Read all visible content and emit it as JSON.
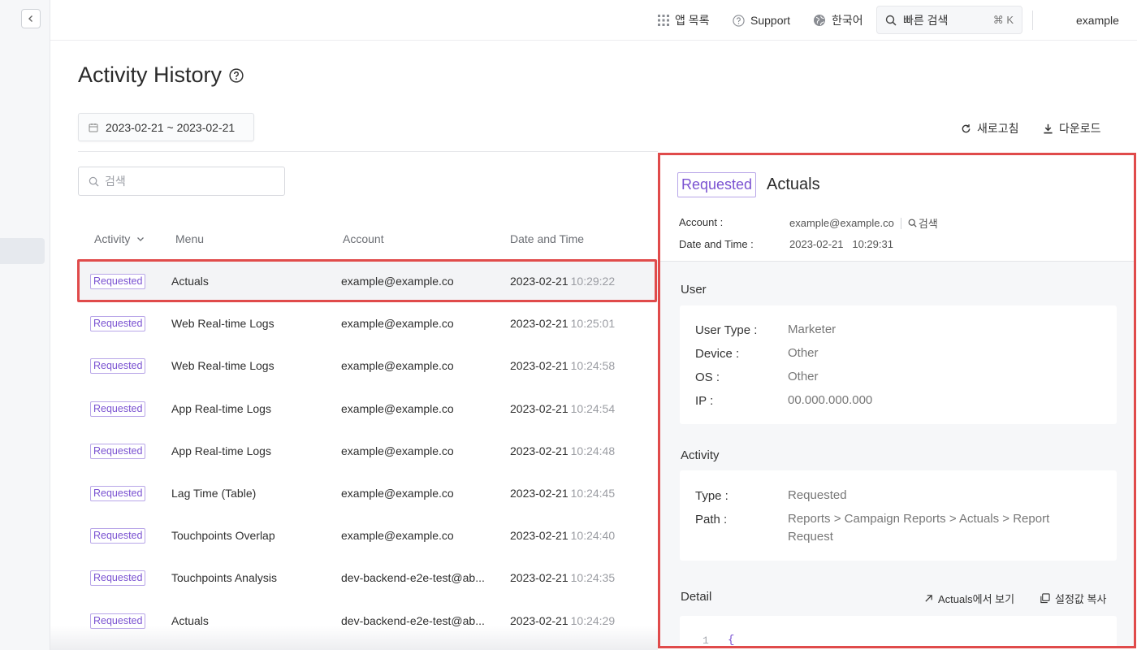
{
  "topbar": {
    "apps_label": "앱 목록",
    "support_label": "Support",
    "language_label": "한국어",
    "quick_search_label": "빠른 검색",
    "quick_search_shortcut": "⌘ K",
    "user_label": "example"
  },
  "page": {
    "title": "Activity History",
    "date_range": "2023-02-21 ~ 2023-02-21",
    "refresh_label": "새로고침",
    "download_label": "다운로드",
    "search_placeholder": "검색"
  },
  "table": {
    "columns": {
      "activity": "Activity",
      "menu": "Menu",
      "account": "Account",
      "datetime": "Date and Time"
    },
    "rows": [
      {
        "activity": "Requested",
        "menu": "Actuals",
        "account": "example@example.co",
        "date": "2023-02-21",
        "time": "10:29:22"
      },
      {
        "activity": "Requested",
        "menu": "Web Real-time Logs",
        "account": "example@example.co",
        "date": "2023-02-21",
        "time": "10:25:01"
      },
      {
        "activity": "Requested",
        "menu": "Web Real-time Logs",
        "account": "example@example.co",
        "date": "2023-02-21",
        "time": "10:24:58"
      },
      {
        "activity": "Requested",
        "menu": "App Real-time Logs",
        "account": "example@example.co",
        "date": "2023-02-21",
        "time": "10:24:54"
      },
      {
        "activity": "Requested",
        "menu": "App Real-time Logs",
        "account": "example@example.co",
        "date": "2023-02-21",
        "time": "10:24:48"
      },
      {
        "activity": "Requested",
        "menu": "Lag Time (Table)",
        "account": "example@example.co",
        "date": "2023-02-21",
        "time": "10:24:45"
      },
      {
        "activity": "Requested",
        "menu": "Touchpoints Overlap",
        "account": "example@example.co",
        "date": "2023-02-21",
        "time": "10:24:40"
      },
      {
        "activity": "Requested",
        "menu": "Touchpoints Analysis",
        "account": "dev-backend-e2e-test@ab...",
        "date": "2023-02-21",
        "time": "10:24:35"
      },
      {
        "activity": "Requested",
        "menu": "Actuals",
        "account": "dev-backend-e2e-test@ab...",
        "date": "2023-02-21",
        "time": "10:24:29"
      }
    ]
  },
  "detail": {
    "badge": "Requested",
    "title": "Actuals",
    "account_label": "Account :",
    "account_value": "example@example.co",
    "account_search": "검색",
    "datetime_label": "Date and Time :",
    "datetime_value": "2023-02-21   10:29:31",
    "user_section": "User",
    "user_type_label": "User Type :",
    "user_type_value": "Marketer",
    "device_label": "Device :",
    "device_value": "Other",
    "os_label": "OS :",
    "os_value": "Other",
    "ip_label": "IP :",
    "ip_value": "00.000.000.000",
    "activity_section": "Activity",
    "type_label": "Type :",
    "type_value": "Requested",
    "path_label": "Path :",
    "path_value": "Reports > Campaign Reports > Actuals > Report Request",
    "detail_section": "Detail",
    "view_in_label": "Actuals에서 보기",
    "copy_settings_label": "설정값 복사",
    "code_line_number": "1",
    "code_first_line": "{"
  },
  "colors": {
    "accent_purple": "#7a52d1",
    "highlight_red": "#e04b4b"
  }
}
